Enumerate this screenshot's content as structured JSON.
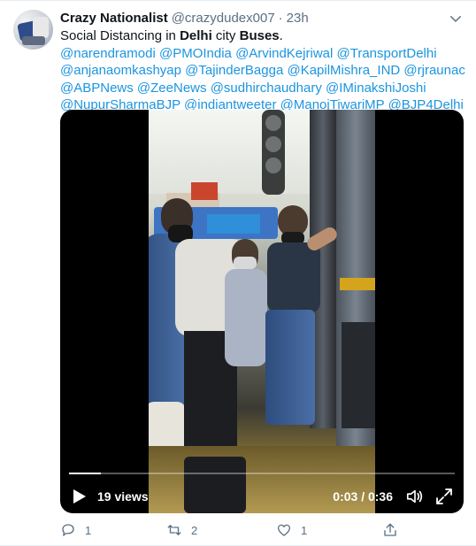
{
  "tweet": {
    "display_name": "Crazy Nationalist",
    "handle": "@crazydudex007",
    "separator": "·",
    "time": "23h",
    "text": {
      "t1": "Social Distancing in ",
      "t2": "Delhi",
      "t3": " city ",
      "t4": "Buses",
      "t5": "."
    },
    "mentions": [
      "@narendramodi",
      "@PMOIndia",
      "@ArvindKejriwal",
      "@TransportDelhi",
      "@anjanaomkashyap",
      "@TajinderBagga",
      "@KapilMishra_IND",
      "@rjraunac",
      "@ABPNews",
      "@ZeeNews",
      "@sudhirchaudhary",
      "@IMinakshiJoshi",
      "@NupurSharmaBJP",
      "@indiantweeter",
      "@ManojTiwariMP",
      "@BJP4Delhi"
    ]
  },
  "video": {
    "views": "19 views",
    "timecode": "0:03 / 0:36",
    "progress": 0.083
  },
  "actions": {
    "reply_count": "1",
    "retweet_count": "2",
    "like_count": "1"
  },
  "icons": {
    "caret": "chevron-down-icon",
    "play": "play-icon",
    "volume": "volume-icon",
    "fullscreen": "fullscreen-icon",
    "reply": "reply-icon",
    "retweet": "retweet-icon",
    "like": "heart-icon",
    "share": "share-icon"
  },
  "colors": {
    "link": "#1b95e0",
    "secondary_text": "#5b7083",
    "video_bg": "#000000"
  }
}
